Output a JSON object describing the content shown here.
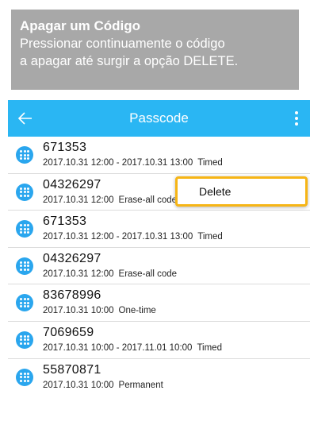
{
  "caption": {
    "title": "Apagar um Código",
    "line1": "Pressionar continuamente o código",
    "line2": "a apagar até surgir a opção DELETE."
  },
  "appbar": {
    "title": "Passcode",
    "back_icon": "arrow-left-icon",
    "menu_icon": "more-vertical-icon"
  },
  "list": [
    {
      "code": "671353",
      "period": "2017.10.31 12:00 - 2017.10.31 13:00",
      "type": "Timed"
    },
    {
      "code": "04326297",
      "period": "2017.10.31 12:00",
      "type": "Erase-all code"
    },
    {
      "code": "671353",
      "period": "2017.10.31 12:00 - 2017.10.31 13:00",
      "type": "Timed"
    },
    {
      "code": "04326297",
      "period": "2017.10.31 12:00",
      "type": "Erase-all code"
    },
    {
      "code": "83678996",
      "period": "2017.10.31 10:00",
      "type": "One-time"
    },
    {
      "code": "7069659",
      "period": "2017.10.31 10:00 - 2017.11.01 10:00",
      "type": "Timed"
    },
    {
      "code": "55870871",
      "period": "2017.10.31 10:00",
      "type": "Permanent"
    }
  ],
  "popup": {
    "delete_label": "Delete"
  },
  "colors": {
    "appbar": "#2ab6f3",
    "icon": "#2aa6ee",
    "highlight": "#f6b516",
    "caption_bg": "#a8a8a8"
  }
}
